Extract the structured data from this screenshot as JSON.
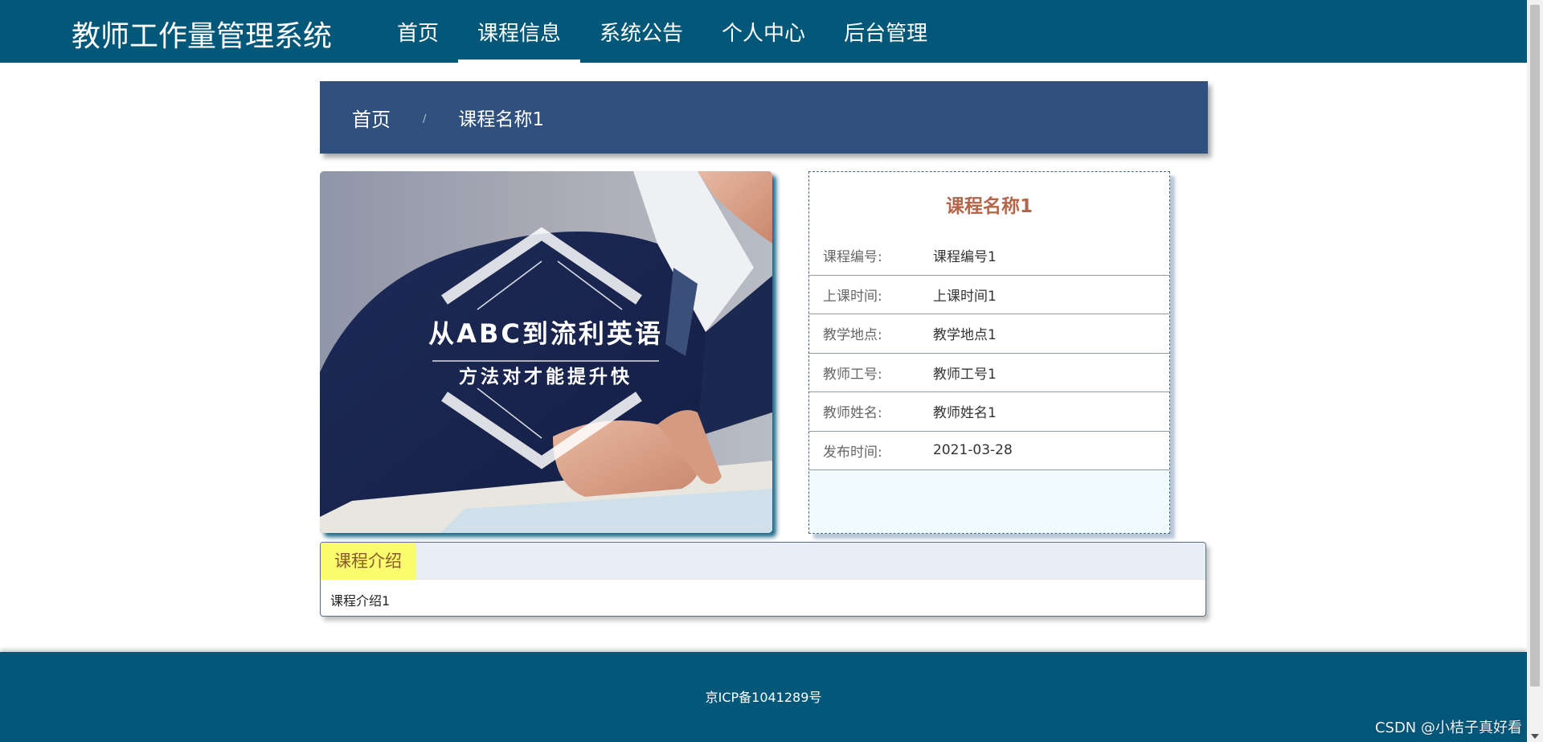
{
  "header": {
    "brand": "教师工作量管理系统",
    "nav": [
      {
        "label": "首页"
      },
      {
        "label": "课程信息"
      },
      {
        "label": "系统公告"
      },
      {
        "label": "个人中心"
      },
      {
        "label": "后台管理"
      }
    ],
    "active_nav": "课程信息"
  },
  "breadcrumb": {
    "home": "首页",
    "separator": "/",
    "current": "课程名称1"
  },
  "cover_image": {
    "line1": "从ABC到流利英语",
    "line2": "方法对才能提升快"
  },
  "detail": {
    "title": "课程名称1",
    "rows": [
      {
        "label": "课程编号:",
        "value": "课程编号1"
      },
      {
        "label": "上课时间:",
        "value": "上课时间1"
      },
      {
        "label": "教学地点:",
        "value": "教学地点1"
      },
      {
        "label": "教师工号:",
        "value": "教师工号1"
      },
      {
        "label": "教师姓名:",
        "value": "教师姓名1"
      },
      {
        "label": "发布时间:",
        "value": "2021-03-28"
      }
    ]
  },
  "intro": {
    "tab_label": "课程介绍",
    "content": "课程介绍1"
  },
  "footer": {
    "icp": "京ICP备1041289号"
  },
  "watermark": "CSDN @小桔子真好看",
  "colors": {
    "header_bg": "#035779",
    "breadcrumb_bg": "#30507e",
    "title_accent": "#b3664a",
    "tab_highlight": "#fbfb6e"
  }
}
